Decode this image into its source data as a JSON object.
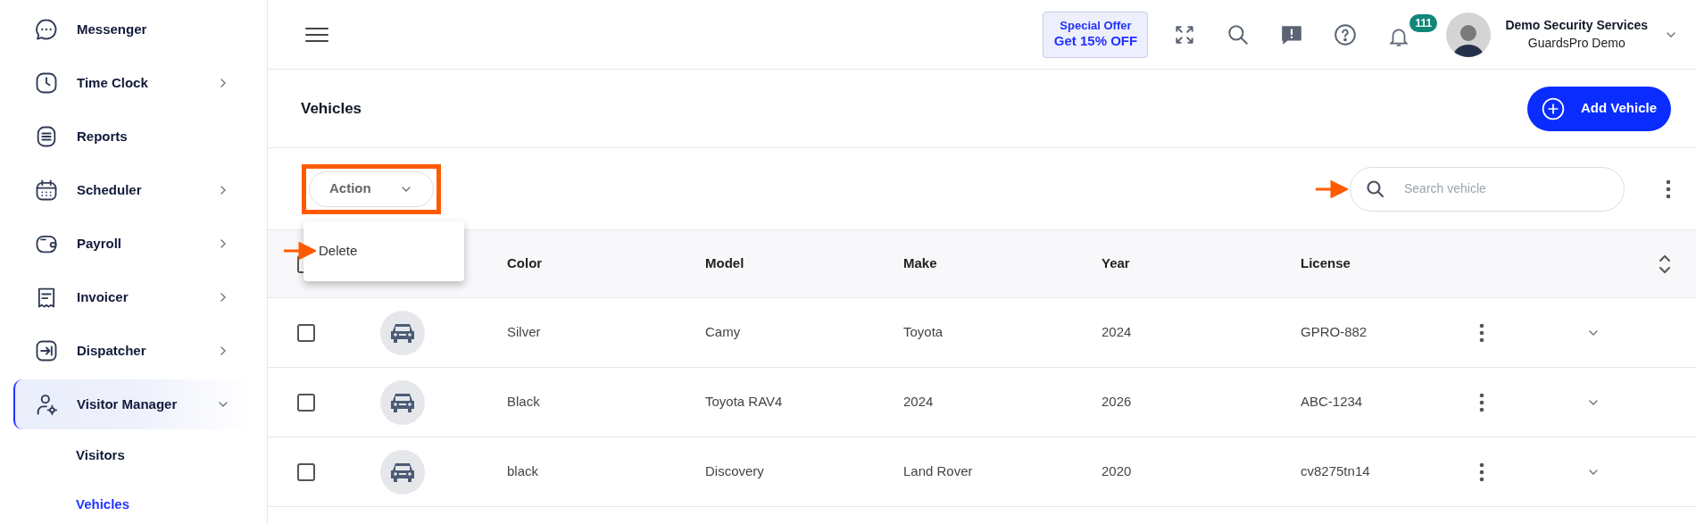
{
  "sidebar": {
    "items": [
      {
        "label": "Messenger",
        "has_submenu": false,
        "selected": false
      },
      {
        "label": "Time Clock",
        "has_submenu": true,
        "expanded": false,
        "selected": false
      },
      {
        "label": "Reports",
        "has_submenu": false,
        "selected": false
      },
      {
        "label": "Scheduler",
        "has_submenu": true,
        "expanded": false,
        "selected": false
      },
      {
        "label": "Payroll",
        "has_submenu": true,
        "expanded": false,
        "selected": false
      },
      {
        "label": "Invoicer",
        "has_submenu": true,
        "expanded": false,
        "selected": false
      },
      {
        "label": "Dispatcher",
        "has_submenu": true,
        "expanded": false,
        "selected": false
      },
      {
        "label": "Visitor Manager",
        "has_submenu": true,
        "expanded": true,
        "selected": true,
        "children": [
          {
            "label": "Visitors",
            "selected": false
          },
          {
            "label": "Vehicles",
            "selected": true
          }
        ]
      }
    ]
  },
  "topbar": {
    "offer": {
      "title": "Special Offer",
      "subtitle": "Get 15% OFF"
    },
    "notification_count": "111",
    "user": {
      "name": "Demo Security Services",
      "company": "GuardsPro Demo"
    }
  },
  "page": {
    "title": "Vehicles",
    "add_button": "Add Vehicle"
  },
  "toolbar": {
    "action": {
      "label": "Action",
      "expanded": true,
      "highlighted": true,
      "menu": [
        {
          "label": "Delete",
          "pointed": true
        }
      ]
    },
    "search": {
      "placeholder": "Search vehicle",
      "pointed": true
    }
  },
  "table": {
    "header_checked": false,
    "columns": [
      "Color",
      "Model",
      "Make",
      "Year",
      "License"
    ],
    "rows": [
      {
        "checked": false,
        "cells": [
          "Silver",
          "Camy",
          "Toyota",
          "2024",
          "GPRO-882"
        ]
      },
      {
        "checked": false,
        "cells": [
          "Black",
          "Toyota RAV4",
          "2024",
          "2026",
          "ABC-1234"
        ]
      },
      {
        "checked": false,
        "cells": [
          "black",
          "Discovery",
          "Land Rover",
          "2020",
          "cv8275tn14"
        ]
      }
    ]
  }
}
